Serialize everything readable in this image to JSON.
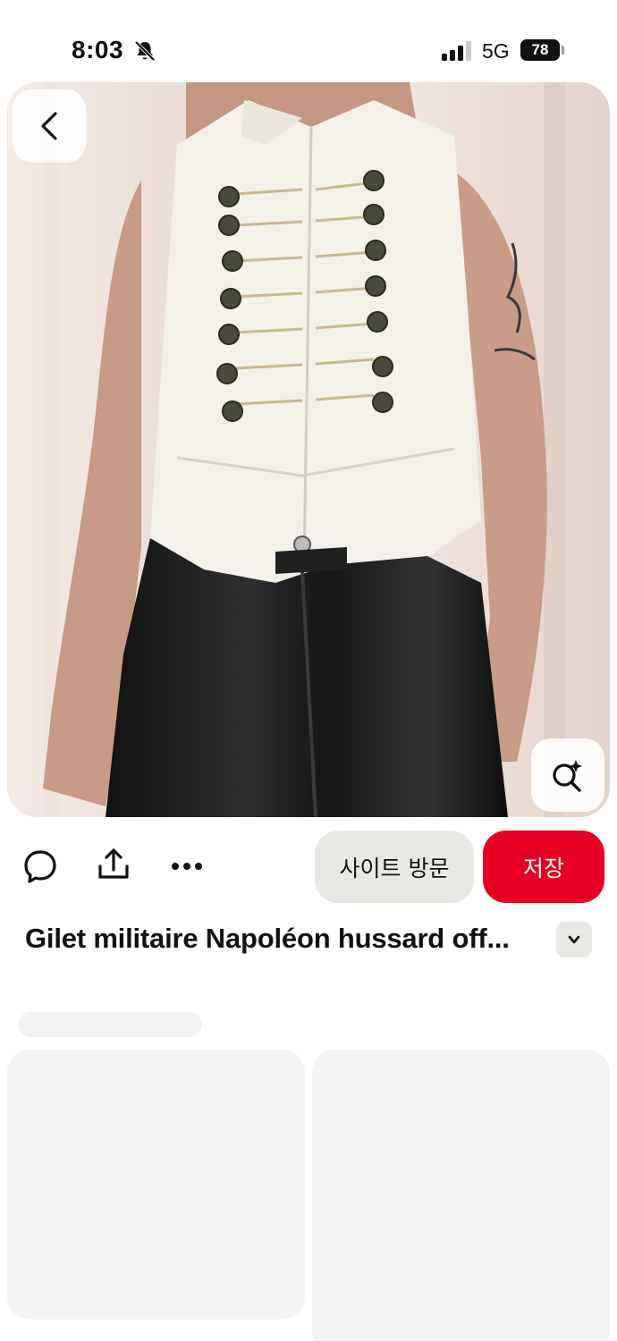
{
  "status_bar": {
    "time": "8:03",
    "network": "5G",
    "battery": "78"
  },
  "icons": {
    "bell_muted": "bell-slash-icon",
    "signal": "cellular-signal-icon",
    "back": "chevron-left-icon",
    "lens": "visual-search-sparkle-icon",
    "comment": "comment-bubble-icon",
    "share": "share-upload-icon",
    "more": "more-dots-icon",
    "expand": "chevron-down-icon"
  },
  "actions": {
    "visit_site": "사이트 방문",
    "save": "저장"
  },
  "pin": {
    "title": "Gilet militaire Napoléon hussard off..."
  },
  "colors": {
    "save_red": "#e60023",
    "pill_gray": "#e9e9e4",
    "skeleton": "#f2f2f0"
  }
}
